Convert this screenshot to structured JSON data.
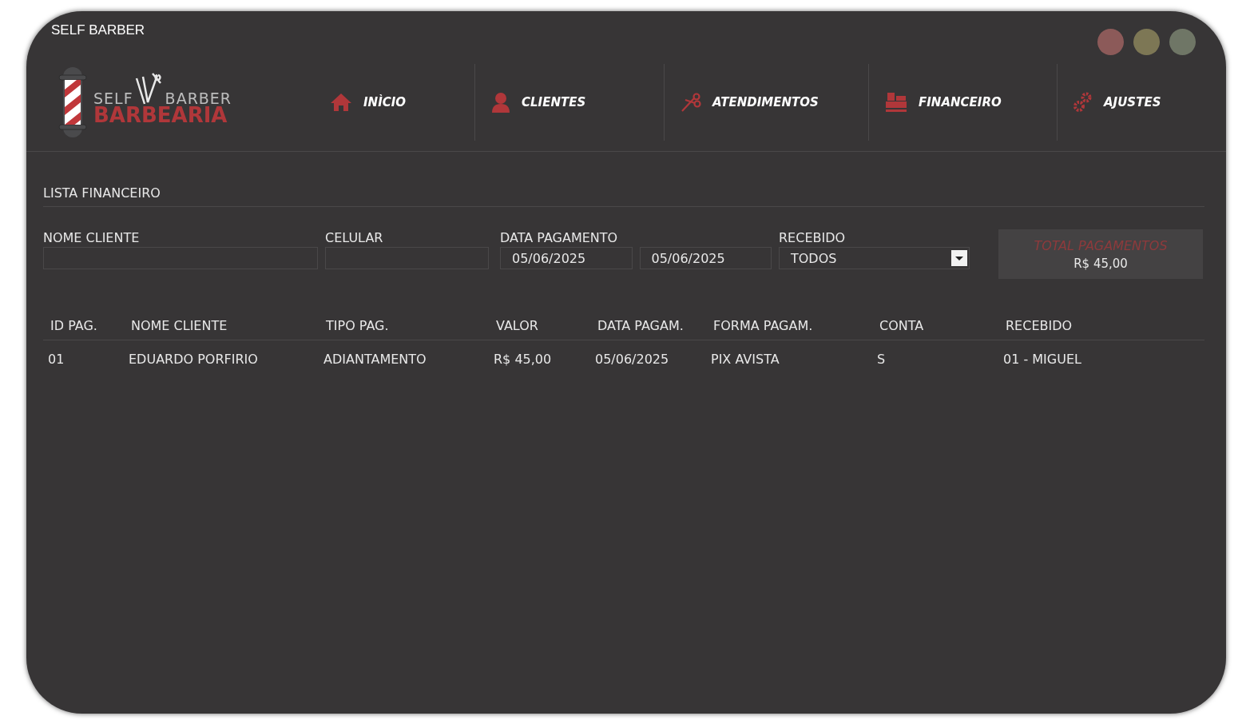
{
  "window": {
    "title": "SELF BARBER"
  },
  "logo": {
    "top_left": "SELF",
    "top_right": "BARBER",
    "bottom": "BARBEARIA"
  },
  "nav": [
    {
      "label": "INÌCIO"
    },
    {
      "label": "CLIENTES"
    },
    {
      "label": "ATENDIMENTOS"
    },
    {
      "label": "FINANCEIRO"
    },
    {
      "label": "AJUSTES"
    }
  ],
  "section_title": "LISTA FINANCEIRO",
  "filters": {
    "nome_cliente": {
      "label": "NOME CLIENTE"
    },
    "celular": {
      "label": "CELULAR"
    },
    "data_pagamento": {
      "label": "DATA PAGAMENTO",
      "from": "05/06/2025",
      "to": "05/06/2025"
    },
    "recebido": {
      "label": "RECEBIDO",
      "value": "TODOS"
    }
  },
  "total": {
    "label": "TOTAL PAGAMENTOS",
    "value": "R$ 45,00"
  },
  "table": {
    "columns": [
      "ID PAG.",
      "NOME CLIENTE",
      "TIPO PAG.",
      "VALOR",
      "DATA PAGAM.",
      "FORMA PAGAM.",
      "CONTA",
      "RECEBIDO"
    ],
    "rows": [
      [
        "01",
        "EDUARDO PORFIRIO",
        "ADIANTAMENTO",
        "R$ 45,00",
        "05/06/2025",
        "PIX AVISTA",
        "S",
        "01 - MIGUEL"
      ]
    ]
  }
}
